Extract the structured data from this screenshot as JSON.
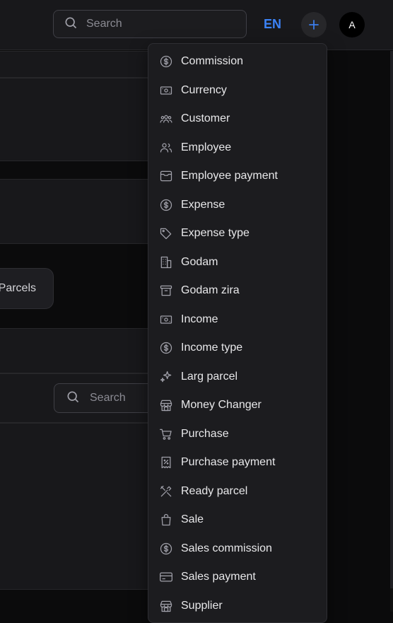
{
  "header": {
    "search_placeholder": "Search",
    "language": "EN",
    "avatar_initial": "A"
  },
  "background": {
    "parcels_label": "Parcels",
    "search_placeholder": "Search"
  },
  "menu": {
    "items": [
      {
        "label": "Commission",
        "icon": "dollar-circle-icon"
      },
      {
        "label": "Currency",
        "icon": "banknote-icon"
      },
      {
        "label": "Customer",
        "icon": "users-group-icon"
      },
      {
        "label": "Employee",
        "icon": "users-icon"
      },
      {
        "label": "Employee payment",
        "icon": "wallet-icon"
      },
      {
        "label": "Expense",
        "icon": "dollar-circle-icon"
      },
      {
        "label": "Expense type",
        "icon": "tag-icon"
      },
      {
        "label": "Godam",
        "icon": "building-icon"
      },
      {
        "label": "Godam zira",
        "icon": "archive-icon"
      },
      {
        "label": "Income",
        "icon": "banknote-icon"
      },
      {
        "label": "Income type",
        "icon": "dollar-circle-icon"
      },
      {
        "label": "Larg parcel",
        "icon": "sparkles-icon"
      },
      {
        "label": "Money Changer",
        "icon": "store-icon"
      },
      {
        "label": "Purchase",
        "icon": "cart-icon"
      },
      {
        "label": "Purchase payment",
        "icon": "receipt-icon"
      },
      {
        "label": "Ready parcel",
        "icon": "tools-icon"
      },
      {
        "label": "Sale",
        "icon": "shopping-bag-icon"
      },
      {
        "label": "Sales commission",
        "icon": "dollar-circle-icon"
      },
      {
        "label": "Sales payment",
        "icon": "credit-card-icon"
      },
      {
        "label": "Supplier",
        "icon": "store-icon"
      }
    ]
  },
  "colors": {
    "accent": "#3b82f6",
    "menu_bg": "#1c1c1f",
    "page_bg": "#0b0b0c"
  }
}
